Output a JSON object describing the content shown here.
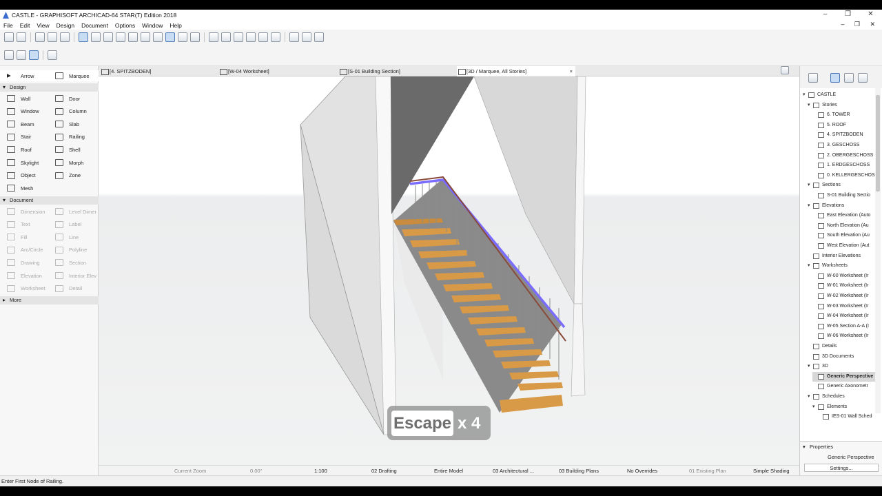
{
  "window": {
    "title": "CASTLE - GRAPHISOFT ARCHICAD-64 STAR(T) Edition 2018",
    "controls": [
      "–",
      "❐",
      "✕"
    ]
  },
  "menu": [
    "File",
    "Edit",
    "View",
    "Design",
    "Document",
    "Options",
    "Window",
    "Help"
  ],
  "menu_controls": "– ❐ ✕",
  "toolbox": {
    "arrow": "Arrow",
    "marquee": "Marquee",
    "design_header": "Design",
    "design_tools": [
      [
        "Wall",
        "Door"
      ],
      [
        "Window",
        "Column"
      ],
      [
        "Beam",
        "Slab"
      ],
      [
        "Stair",
        "Railing"
      ],
      [
        "Roof",
        "Shell"
      ],
      [
        "Skylight",
        "Morph"
      ],
      [
        "Object",
        "Zone"
      ],
      [
        "Mesh",
        ""
      ]
    ],
    "document_header": "Document",
    "document_tools": [
      [
        "Dimension",
        "Level Dimer"
      ],
      [
        "Text",
        "Label"
      ],
      [
        "Fill",
        "Line"
      ],
      [
        "Arc/Circle",
        "Polyline"
      ],
      [
        "Drawing",
        "Section"
      ],
      [
        "Elevation",
        "Interior Elev"
      ],
      [
        "Worksheet",
        "Detail"
      ]
    ],
    "more": "More"
  },
  "tabs": [
    {
      "label": "[4. SPITZBODEN]"
    },
    {
      "label": "[W-04 Worksheet]"
    },
    {
      "label": "[S-01 Building Section]"
    },
    {
      "label": "[3D / Marquee, All Stories]",
      "close": "×"
    }
  ],
  "keystroke": {
    "key": "Escape",
    "count": "x 4"
  },
  "navigator": {
    "tree": [
      {
        "label": "CASTLE",
        "depth": 0,
        "tw": "▾"
      },
      {
        "label": "Stories",
        "depth": 1,
        "tw": "▾"
      },
      {
        "label": "6. TOWER",
        "depth": 2
      },
      {
        "label": "5. ROOF",
        "depth": 2
      },
      {
        "label": "4. SPITZBODEN",
        "depth": 2
      },
      {
        "label": "3. GESCHOSS",
        "depth": 2
      },
      {
        "label": "2. OBERGESCHOSS",
        "depth": 2
      },
      {
        "label": "1. ERDGESCHOSS",
        "depth": 2
      },
      {
        "label": "0. KELLERGESCHOSS",
        "depth": 2
      },
      {
        "label": "Sections",
        "depth": 1,
        "tw": "▾"
      },
      {
        "label": "S-01 Building Sectio",
        "depth": 2
      },
      {
        "label": "Elevations",
        "depth": 1,
        "tw": "▾"
      },
      {
        "label": "East Elevation (Auto",
        "depth": 2
      },
      {
        "label": "North Elevation (Au",
        "depth": 2
      },
      {
        "label": "South Elevation (Au",
        "depth": 2
      },
      {
        "label": "West Elevation (Aut",
        "depth": 2
      },
      {
        "label": "Interior Elevations",
        "depth": 1
      },
      {
        "label": "Worksheets",
        "depth": 1,
        "tw": "▾"
      },
      {
        "label": "W-00 Worksheet (Ir",
        "depth": 2
      },
      {
        "label": "W-01 Worksheet (Ir",
        "depth": 2
      },
      {
        "label": "W-02 Worksheet (Ir",
        "depth": 2
      },
      {
        "label": "W-03 Worksheet (Ir",
        "depth": 2
      },
      {
        "label": "W-04 Worksheet (Ir",
        "depth": 2
      },
      {
        "label": "W-05 Section A-A (I",
        "depth": 2
      },
      {
        "label": "W-06 Worksheet (Ir",
        "depth": 2
      },
      {
        "label": "Details",
        "depth": 1
      },
      {
        "label": "3D Documents",
        "depth": 1
      },
      {
        "label": "3D",
        "depth": 1,
        "tw": "▾"
      },
      {
        "label": "Generic Perspective",
        "depth": 2,
        "selected": true
      },
      {
        "label": "Generic Axonometr",
        "depth": 2
      },
      {
        "label": "Schedules",
        "depth": 1,
        "tw": "▾"
      },
      {
        "label": "Elements",
        "depth": 2,
        "tw": "▾"
      },
      {
        "label": "IES-01 Wall Sched",
        "depth": 3
      }
    ]
  },
  "properties": {
    "header": "Properties",
    "value": "Generic Perspective",
    "settings": "Settings..."
  },
  "viewbar": {
    "zoom": "Current Zoom",
    "angle": "0.00°",
    "scale": "1:100",
    "layer": "02 Drafting",
    "model": "Entire Model",
    "pen": "03 Architectural ...",
    "plans": "03 Building Plans",
    "overrides": "No Overrides",
    "renovation": "01 Existing Plan",
    "shading": "Simple Shading"
  },
  "status": "Enter First Node of Railing."
}
